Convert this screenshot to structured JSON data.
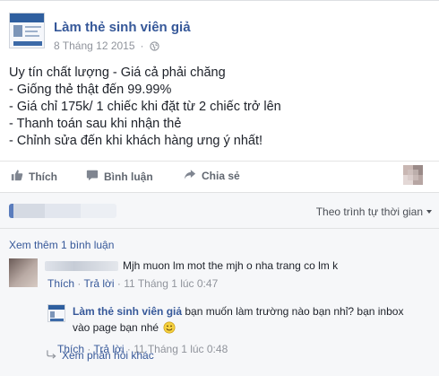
{
  "post": {
    "page_name": "Làm thẻ sinh viên giả",
    "date": "8 Tháng 12 2015",
    "separator": "·",
    "audience_icon": "globe-icon",
    "lines": [
      "Uy tín chất lượng - Giá cả phải chăng",
      "- Giống thẻ thật đến 99.99%",
      "- Giá chỉ 175k/ 1 chiếc khi đặt từ 2 chiếc trở lên",
      "- Thanh toán sau khi nhận thẻ",
      "- Chỉnh sửa đến khi khách hàng ưng ý nhất!"
    ]
  },
  "actions": {
    "like": "Thích",
    "comment": "Bình luận",
    "share": "Chia sẻ"
  },
  "comments": {
    "sort_label": "Theo trình tự thời gian",
    "view_more": "Xem thêm 1 bình luận",
    "items": [
      {
        "text": "Mjh muon lm mot the mjh o nha trang co lm k",
        "like": "Thích",
        "sep": "·",
        "reply": "Trả lời",
        "time": "11 Tháng 1 lúc 0:47"
      }
    ],
    "reply": {
      "author": "Làm thẻ sinh viên giả",
      "text": "bạn muốn làm trường nào bạn nhỉ? bạn inbox vào page bạn nhé",
      "emoji_icon": "smile-emoji-icon",
      "like": "Thích",
      "sep": "·",
      "reply": "Trả lời",
      "time": "11 Tháng 1 lúc 0:48"
    },
    "more_replies": "Xem phản hồi khác"
  },
  "colors": {
    "link": "#365899",
    "meta": "#90949c",
    "comments_bg": "#f6f7f9"
  }
}
